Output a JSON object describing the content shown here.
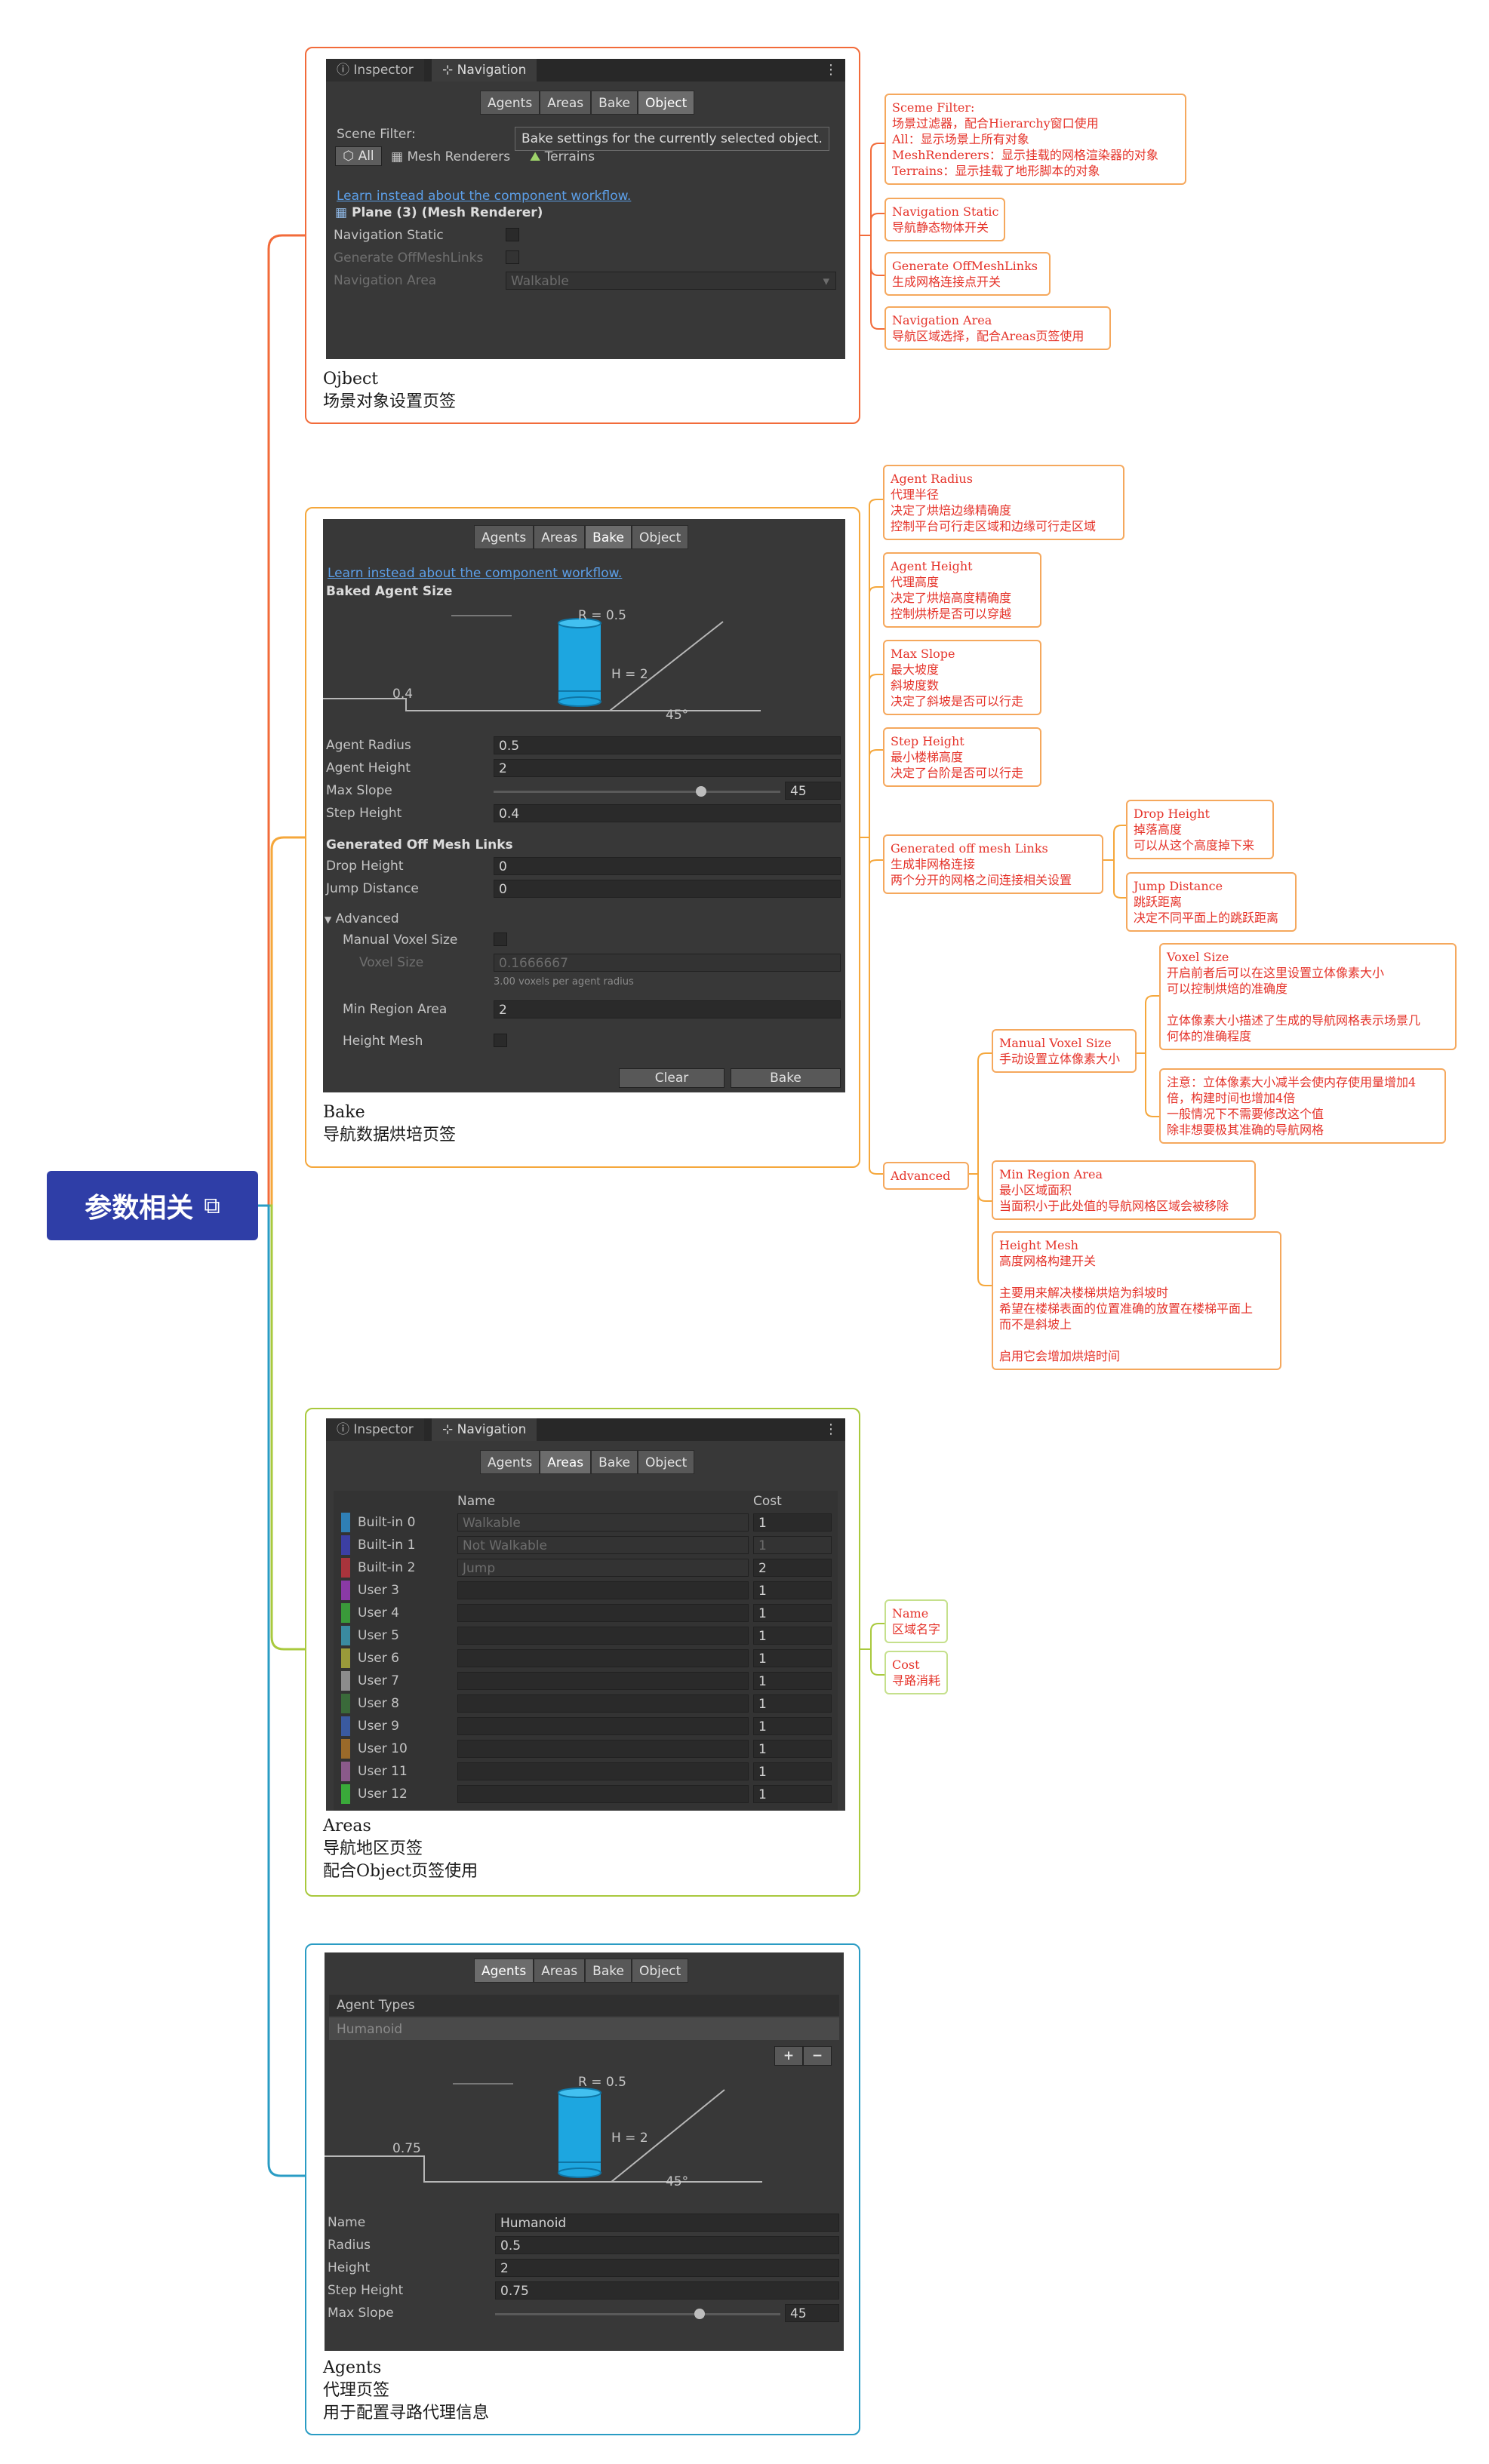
{
  "root": {
    "title": "参数相关",
    "link_icon": "link-icon"
  },
  "colors": {
    "root_bg": "#2f3ea7",
    "branch_object": "#f26b3a",
    "branch_bake": "#f5a73b",
    "branch_areas": "#a9c93d",
    "branch_agents": "#2a9cc4",
    "note_text": "#e5332a"
  },
  "object_card": {
    "caption": "Ojbect\n场景对象设置页签",
    "window_tabs": [
      "Inspector",
      "Navigation"
    ],
    "tabs": [
      "Agents",
      "Areas",
      "Bake",
      "Object"
    ],
    "active_tab": "Object",
    "scene_filter_label": "Scene Filter:",
    "filters": [
      "All",
      "Mesh Renderers",
      "Terrains"
    ],
    "tooltip": "Bake settings for the currently selected object.",
    "workflow_link": "Learn instead about the component workflow.",
    "selected_object": "Plane (3) (Mesh Renderer)",
    "nav_static": "Navigation Static",
    "gen_offmesh": "Generate OffMeshLinks",
    "nav_area": "Navigation Area",
    "nav_area_value": "Walkable"
  },
  "bake_card": {
    "caption": "Bake\n导航数据烘培页签",
    "tabs": [
      "Agents",
      "Areas",
      "Bake",
      "Object"
    ],
    "active_tab": "Bake",
    "workflow_link": "Learn instead about the component workflow.",
    "baked_agent_size": "Baked Agent Size",
    "diagram": {
      "r_label": "R = 0.5",
      "h_label": "H = 2",
      "step_label": "0.4",
      "slope_label": "45°"
    },
    "fields": [
      {
        "label": "Agent Radius",
        "value": "0.5"
      },
      {
        "label": "Agent Height",
        "value": "2"
      },
      {
        "label": "Max Slope",
        "value": "45"
      },
      {
        "label": "Step Height",
        "value": "0.4"
      }
    ],
    "offmesh_title": "Generated Off Mesh Links",
    "drop_height": {
      "label": "Drop Height",
      "value": "0"
    },
    "jump_distance": {
      "label": "Jump Distance",
      "value": "0"
    },
    "advanced": "Advanced",
    "manual_voxel": "Manual Voxel Size",
    "voxel_size": {
      "label": "Voxel Size",
      "value": "0.1666667"
    },
    "voxel_hint": "3.00 voxels per agent radius",
    "min_region": {
      "label": "Min Region Area",
      "value": "2"
    },
    "height_mesh": "Height Mesh",
    "clear_button": "Clear",
    "bake_button": "Bake"
  },
  "areas_card": {
    "caption": "Areas\n导航地区页签\n配合Object页签使用",
    "window_tabs": [
      "Inspector",
      "Navigation"
    ],
    "tabs": [
      "Agents",
      "Areas",
      "Bake",
      "Object"
    ],
    "active_tab": "Areas",
    "col_name": "Name",
    "col_cost": "Cost",
    "rows": [
      {
        "label": "Built-in 0",
        "name": "Walkable",
        "cost": "1",
        "color": "#2f7fb5",
        "dim_cost": false
      },
      {
        "label": "Built-in 1",
        "name": "Not Walkable",
        "cost": "1",
        "color": "#3c3fa3",
        "dim_cost": true
      },
      {
        "label": "Built-in 2",
        "name": "Jump",
        "cost": "2",
        "color": "#a8343c",
        "dim_cost": false
      },
      {
        "label": "User 3",
        "name": "",
        "cost": "1",
        "color": "#8a3aa6",
        "dim_cost": false
      },
      {
        "label": "User 4",
        "name": "",
        "cost": "1",
        "color": "#3a9a3a",
        "dim_cost": false
      },
      {
        "label": "User 5",
        "name": "",
        "cost": "1",
        "color": "#3a8aa0",
        "dim_cost": false
      },
      {
        "label": "User 6",
        "name": "",
        "cost": "1",
        "color": "#9a9a3a",
        "dim_cost": false
      },
      {
        "label": "User 7",
        "name": "",
        "cost": "1",
        "color": "#8c8c8c",
        "dim_cost": false
      },
      {
        "label": "User 8",
        "name": "",
        "cost": "1",
        "color": "#3a6a3a",
        "dim_cost": false
      },
      {
        "label": "User 9",
        "name": "",
        "cost": "1",
        "color": "#3a5aa0",
        "dim_cost": false
      },
      {
        "label": "User 10",
        "name": "",
        "cost": "1",
        "color": "#9a6a2a",
        "dim_cost": false
      },
      {
        "label": "User 11",
        "name": "",
        "cost": "1",
        "color": "#8a5a8a",
        "dim_cost": false
      },
      {
        "label": "User 12",
        "name": "",
        "cost": "1",
        "color": "#3aaa3a",
        "dim_cost": false
      }
    ]
  },
  "agents_card": {
    "caption": "Agents\n代理页签\n用于配置寻路代理信息",
    "tabs": [
      "Agents",
      "Areas",
      "Bake",
      "Object"
    ],
    "active_tab": "Agents",
    "agent_types": "Agent Types",
    "agent_item": "Humanoid",
    "plus": "+",
    "minus": "−",
    "diagram": {
      "r_label": "R = 0.5",
      "h_label": "H = 2",
      "step_label": "0.75",
      "slope_label": "45°"
    },
    "fields": [
      {
        "label": "Name",
        "value": "Humanoid"
      },
      {
        "label": "Radius",
        "value": "0.5"
      },
      {
        "label": "Height",
        "value": "2"
      },
      {
        "label": "Step Height",
        "value": "0.75"
      },
      {
        "label": "Max Slope",
        "value": "45"
      }
    ]
  },
  "notes": {
    "scene_filter": "Sceme Filter:\n场景过滤器，配合Hierarchy窗口使用\nAll：显示场景上所有对象\nMeshRenderers：显示挂载的网格渲染器的对象\nTerrains：显示挂载了地形脚本的对象",
    "nav_static": "Navigation Static\n导航静态物体开关",
    "gen_offmesh": "Generate OffMeshLinks\n生成网格连接点开关",
    "nav_area": "Navigation Area\n导航区域选择，配合Areas页签使用",
    "agent_radius": "Agent Radius\n代理半径\n决定了烘焙边缘精确度\n控制平台可行走区域和边缘可行走区域",
    "agent_height": "Agent Height\n代理高度\n决定了烘焙高度精确度\n控制烘桥是否可以穿越",
    "max_slope": "Max Slope\n最大坡度\n斜坡度数\n决定了斜坡是否可以行走",
    "step_height": "Step Height\n最小楼梯高度\n决定了台阶是否可以行走",
    "gen_offmesh_links": "Generated off mesh Links\n生成非网格连接\n两个分开的网格之间连接相关设置",
    "drop_height": "Drop Height\n掉落高度\n可以从这个高度掉下来",
    "jump_distance": "Jump Distance\n跳跃距离\n决定不同平面上的跳跃距离",
    "advanced": "Advanced",
    "manual_voxel": "Manual Voxel Size\n手动设置立体像素大小",
    "voxel_size": "Voxel Size\n开启前者后可以在这里设置立体像素大小\n可以控制烘焙的准确度\n\n立体像素大小描述了生成的导航网格表示场景几\n何体的准确程度",
    "voxel_warning": "注意：立体像素大小减半会使内存使用量增加4\n倍，构建时间也增加4倍\n一般情况下不需要修改这个值\n除非想要极其准确的导航网格",
    "min_region": "Min Region Area\n最小区域面积\n当面积小于此处值的导航网格区域会被移除",
    "height_mesh": "Height Mesh\n高度网格构建开关\n\n主要用来解决楼梯烘焙为斜坡时\n希望在楼梯表面的位置准确的放置在楼梯平面上\n而不是斜坡上\n\n启用它会增加烘焙时间",
    "area_name": "Name\n区域名字",
    "area_cost": "Cost\n寻路消耗"
  }
}
